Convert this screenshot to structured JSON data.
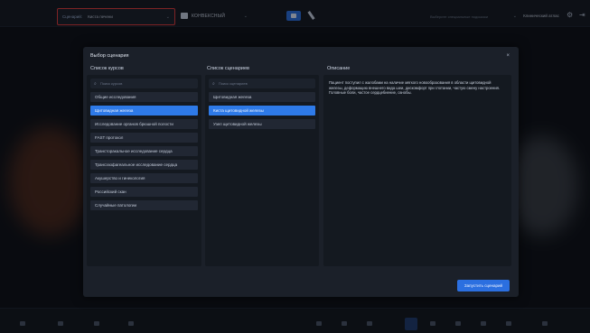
{
  "topbar": {
    "scenario_label": "Сценарий:",
    "scenario_value": "Киста печени",
    "preset_value": "КОНВЕКСНЫЙ",
    "structure_placeholder": "Выберите специальные подсказки",
    "clinic_button": "Клинический атлас"
  },
  "modal": {
    "title": "Выбор сценария",
    "close_label": "×",
    "courses": {
      "title": "Список курсов",
      "search_placeholder": "Поиск курсов",
      "items": [
        {
          "label": "Общие исследования"
        },
        {
          "label": "Щитовидная железа"
        },
        {
          "label": "Исследование органов брюшной полости"
        },
        {
          "label": "FAST протокол"
        },
        {
          "label": "Трансторакальное исследование сердца"
        },
        {
          "label": "Трансэзофагеальное исследование сердца"
        },
        {
          "label": "Акушерство и гинекология"
        },
        {
          "label": "Российский скан"
        },
        {
          "label": "Случайные патологии"
        }
      ],
      "active_index": 1
    },
    "scenarios": {
      "title": "Список сценариев",
      "search_placeholder": "Поиск сценариев",
      "items": [
        {
          "label": "Щитовидная железа"
        },
        {
          "label": "Киста щитовидной железы"
        },
        {
          "label": "Узел щитовидной железы"
        }
      ],
      "active_index": 1
    },
    "description": {
      "title": "Описание",
      "text": "Пациент поступил с жалобами на наличие мягкого новообразования в области щитовидной железы, деформацию внешнего вида шеи, дискомфорт при глотании, частую смену настроения. Головные боли, частое сердцебиение, ознобы."
    },
    "run_button": "Запустить сценарий"
  },
  "colors": {
    "accent": "#2b6fe0",
    "highlight": "#e23b3b",
    "modal_bg": "#1b2029"
  }
}
